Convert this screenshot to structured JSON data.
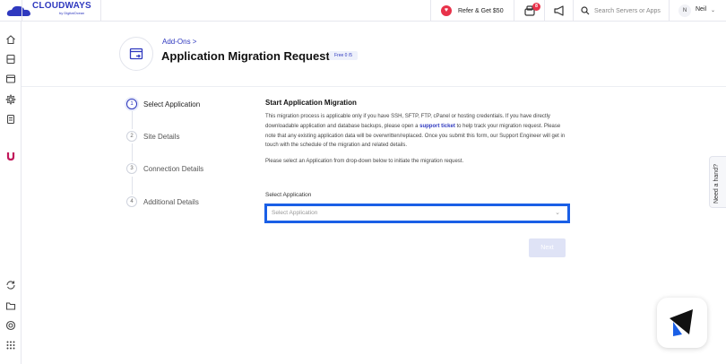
{
  "brand": {
    "name": "CLOUDWAYS",
    "sub": "by DigitalOcean",
    "color": "#2f39bf"
  },
  "topbar": {
    "refer_label": "Refer & Get $50",
    "notification_count": "8",
    "search_placeholder": "Search Servers or Apps",
    "user_initial": "N",
    "user_name": "Neil"
  },
  "sidebar": {
    "top_icons": [
      "home-icon",
      "server-icon",
      "window-icon",
      "settings-gear-icon",
      "document-stack-icon",
      "u-brand-icon"
    ],
    "bottom_icons": [
      "sync-icon",
      "folder-icon",
      "support-icon",
      "apps-grid-icon"
    ]
  },
  "header": {
    "breadcrumb": "Add-Ons >",
    "title": "Application Migration Request",
    "free_badge": "Free 0 /5"
  },
  "steps": [
    {
      "num": "1",
      "label": "Select Application",
      "active": true
    },
    {
      "num": "2",
      "label": "Site Details",
      "active": false
    },
    {
      "num": "3",
      "label": "Connection Details",
      "active": false
    },
    {
      "num": "4",
      "label": "Additional Details",
      "active": false
    }
  ],
  "content": {
    "heading": "Start Application Migration",
    "desc_part1": "This migration process is applicable only if you have SSH, SFTP, FTP, cPanel or hosting credentials. If you have directly downloadable application and database backups, please open a ",
    "desc_link": "support ticket",
    "desc_part2": " to help track your migration request. Please note that any existing application data will be overwritten/replaced. Once you submit this form, our Support Engineer will get in touch with the schedule of the migration and related details.",
    "instruction": "Please select an Application from drop-down below to initiate the migration request.",
    "field_label": "Select Application",
    "select_placeholder": "Select Application",
    "next_label": "Next"
  },
  "help_tab": "Need a hand?",
  "colors": {
    "accent": "#2f39bf",
    "focus_border": "#1a5fe6",
    "badge": "#e8324a"
  }
}
